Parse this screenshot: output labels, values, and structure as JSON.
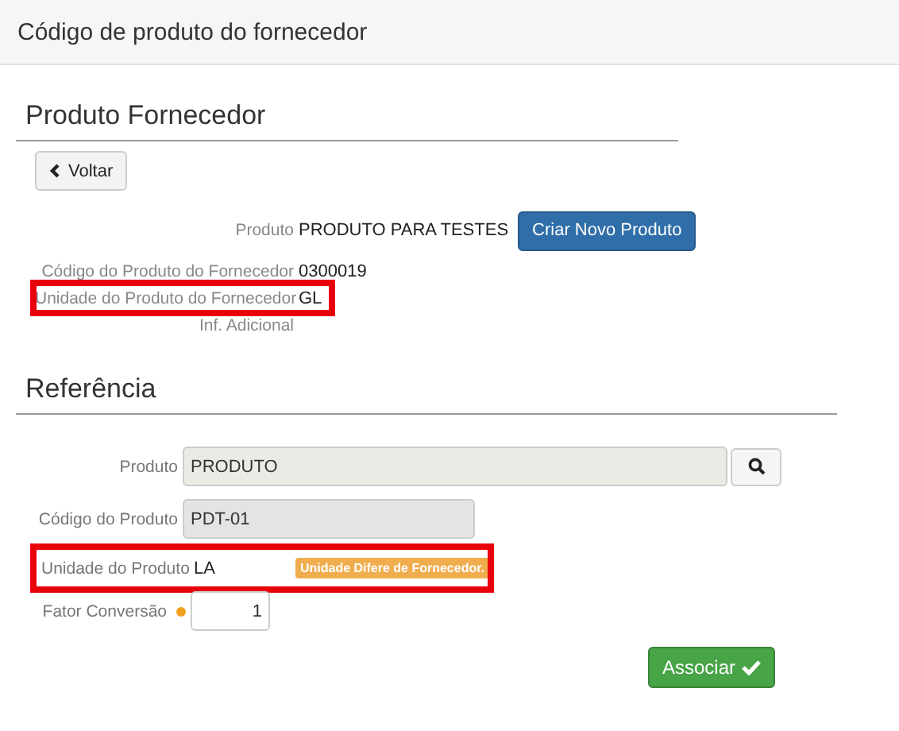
{
  "window": {
    "title": "Código de produto do fornecedor"
  },
  "supplier_section": {
    "title": "Produto Fornecedor",
    "back_button": "Voltar",
    "fields": [
      {
        "label": "Produto",
        "value": "PRODUTO PARA TESTES",
        "highlighted": false,
        "action": "Criar Novo Produto"
      },
      {
        "label": "Código do Produto do Fornecedor",
        "value": "0300019",
        "highlighted": false
      },
      {
        "label": "Unidade do Produto do Fornecedor",
        "value": "GL",
        "highlighted": true
      },
      {
        "label": "Inf. Adicional",
        "highlighted": false
      }
    ]
  },
  "reference_section": {
    "title": "Referência",
    "product": {
      "label": "Produto",
      "value": "PRODUTO"
    },
    "code": {
      "label": "Código do Produto",
      "value": "PDT-01"
    },
    "unit": {
      "label": "Unidade do Produto",
      "value": "LA",
      "warning": "Unidade Difere de Fornecedor.",
      "highlighted": true
    },
    "factor": {
      "label": "Fator Conversão",
      "value": "1",
      "required": true
    },
    "submit_button": "Associar"
  }
}
